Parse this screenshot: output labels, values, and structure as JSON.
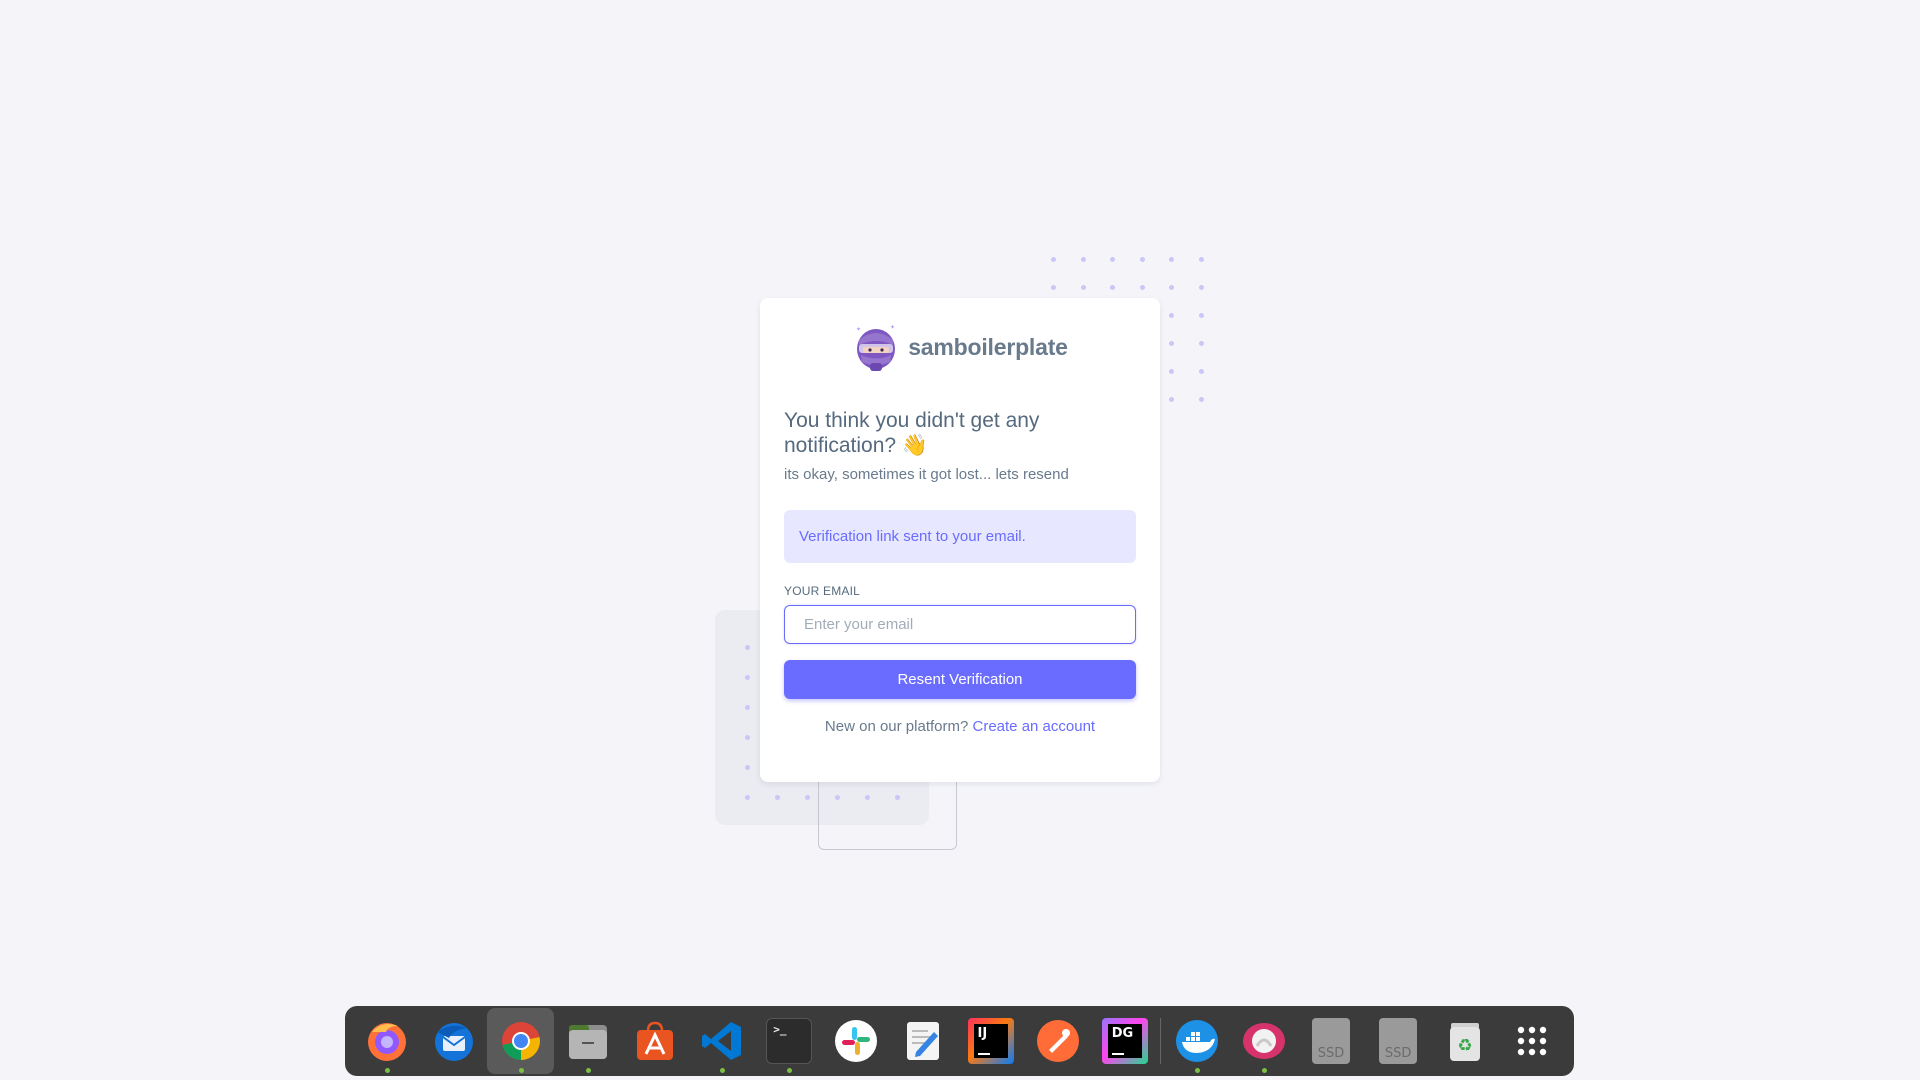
{
  "brand": {
    "name": "samboilerplate"
  },
  "page": {
    "heading": "You think you didn't get any notification? 👋",
    "subtext": "its okay, sometimes it got lost... lets resend",
    "alert": "Verification link sent to your email.",
    "email_label": "YOUR EMAIL",
    "email_placeholder": "Enter your email",
    "email_value": "",
    "submit_label": "Resent Verification",
    "footer_prompt": "New on our platform?",
    "footer_link": "Create an account"
  },
  "colors": {
    "primary": "#696cff",
    "alert_bg": "#e7e7ff",
    "page_bg": "#f5f5f9",
    "dock_bg": "#3b3b3b"
  },
  "dock": {
    "items": [
      {
        "name": "firefox-icon",
        "running": true
      },
      {
        "name": "thunderbird-icon",
        "running": false
      },
      {
        "name": "chrome-icon",
        "running": true,
        "active": true
      },
      {
        "name": "files-icon",
        "running": true
      },
      {
        "name": "app-store-icon",
        "running": false
      },
      {
        "name": "vscode-icon",
        "running": true
      },
      {
        "name": "terminal-icon",
        "running": true
      },
      {
        "name": "slack-icon",
        "running": false
      },
      {
        "name": "text-editor-icon",
        "running": false
      },
      {
        "name": "intellij-icon",
        "running": false
      },
      {
        "name": "postman-icon",
        "running": false
      },
      {
        "name": "datagrip-icon",
        "running": false
      },
      {
        "name": "docker-icon",
        "running": true
      },
      {
        "name": "disk-usage-icon",
        "running": true
      },
      {
        "name": "ssd-drive-icon",
        "running": false
      },
      {
        "name": "ssd-drive-icon",
        "running": false
      },
      {
        "name": "trash-icon",
        "running": false
      },
      {
        "name": "app-grid-icon",
        "running": false
      }
    ],
    "terminal_glyph": ">_",
    "intellij_label": "IJ",
    "datagrip_label": "DG",
    "ssd_label": "SSD"
  }
}
